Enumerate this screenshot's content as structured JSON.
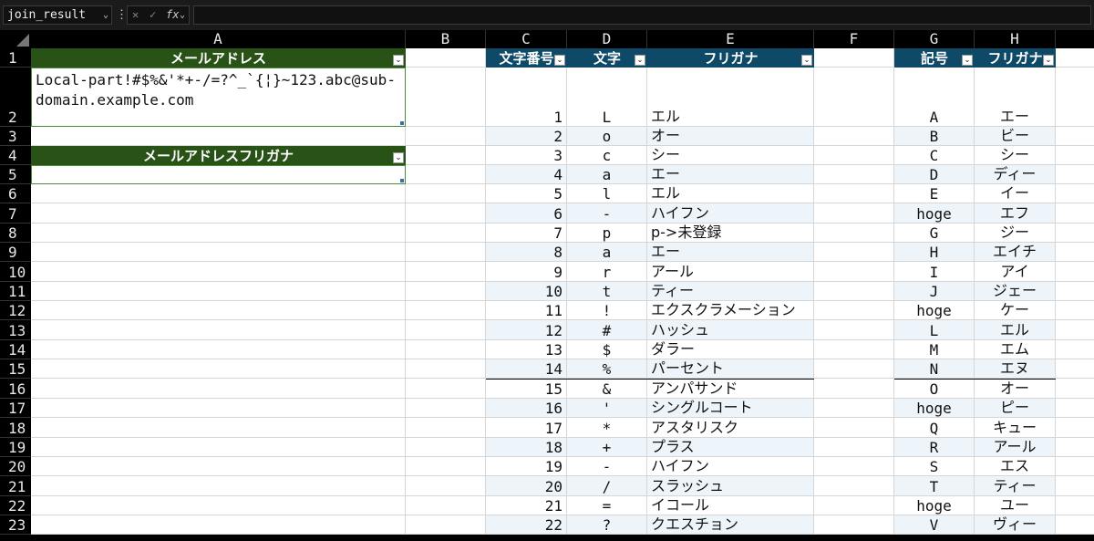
{
  "formula_bar": {
    "name_box": "join_result",
    "name_box_dropdown": "⌄",
    "more": "⋮",
    "cancel": "✕",
    "enter": "✓",
    "fx": "fx",
    "fx_dropdown": "⌄",
    "formula": ""
  },
  "columns": [
    "A",
    "B",
    "C",
    "D",
    "E",
    "F",
    "G",
    "H"
  ],
  "table1": {
    "header": "メールアドレス",
    "value": "Local-part!#$%&'*+-/=?^_`{¦}~123.abc@sub-domain.example.com"
  },
  "table2": {
    "header": "メールアドレスフリガナ",
    "value": ""
  },
  "table3": {
    "headers": [
      "文字番号",
      "文字",
      "フリガナ"
    ],
    "rows": [
      [
        "1",
        "L",
        "エル"
      ],
      [
        "2",
        "o",
        "オー"
      ],
      [
        "3",
        "c",
        "シー"
      ],
      [
        "4",
        "a",
        "エー"
      ],
      [
        "5",
        "l",
        "エル"
      ],
      [
        "6",
        "-",
        "ハイフン"
      ],
      [
        "7",
        "p",
        "p->未登録"
      ],
      [
        "8",
        "a",
        "エー"
      ],
      [
        "9",
        "r",
        "アール"
      ],
      [
        "10",
        "t",
        "ティー"
      ],
      [
        "11",
        "!",
        "エクスクラメーション"
      ],
      [
        "12",
        "#",
        "ハッシュ"
      ],
      [
        "13",
        "$",
        "ダラー"
      ],
      [
        "14",
        "%",
        "パーセント"
      ],
      [
        "15",
        "&",
        "アンパサンド"
      ],
      [
        "16",
        "'",
        "シングルコート"
      ],
      [
        "17",
        "*",
        "アスタリスク"
      ],
      [
        "18",
        "+",
        "プラス"
      ],
      [
        "19",
        "-",
        "ハイフン"
      ],
      [
        "20",
        "/",
        "スラッシュ"
      ],
      [
        "21",
        "=",
        "イコール"
      ],
      [
        "22",
        "?",
        "クエスチョン"
      ]
    ]
  },
  "table4": {
    "headers": [
      "記号",
      "フリガナ"
    ],
    "rows": [
      [
        "A",
        "エー"
      ],
      [
        "B",
        "ビー"
      ],
      [
        "C",
        "シー"
      ],
      [
        "D",
        "ディー"
      ],
      [
        "E",
        "イー"
      ],
      [
        "hoge",
        "エフ"
      ],
      [
        "G",
        "ジー"
      ],
      [
        "H",
        "エイチ"
      ],
      [
        "I",
        "アイ"
      ],
      [
        "J",
        "ジェー"
      ],
      [
        "hoge",
        "ケー"
      ],
      [
        "L",
        "エル"
      ],
      [
        "M",
        "エム"
      ],
      [
        "N",
        "エヌ"
      ],
      [
        "O",
        "オー"
      ],
      [
        "hoge",
        "ピー"
      ],
      [
        "Q",
        "キュー"
      ],
      [
        "R",
        "アール"
      ],
      [
        "S",
        "エス"
      ],
      [
        "T",
        "ティー"
      ],
      [
        "hoge",
        "ユー"
      ],
      [
        "V",
        "ヴィー"
      ]
    ]
  },
  "row_numbers": [
    "1",
    "2",
    "3",
    "4",
    "5",
    "6",
    "7",
    "8",
    "9",
    "10",
    "11",
    "12",
    "13",
    "14",
    "15",
    "16",
    "17",
    "18",
    "19",
    "20",
    "21",
    "22",
    "23"
  ],
  "filter_icon": "⌄",
  "colors": {
    "green_header": "#295217",
    "blue_header": "#0e4a68",
    "stripe": "#eef5fa"
  }
}
